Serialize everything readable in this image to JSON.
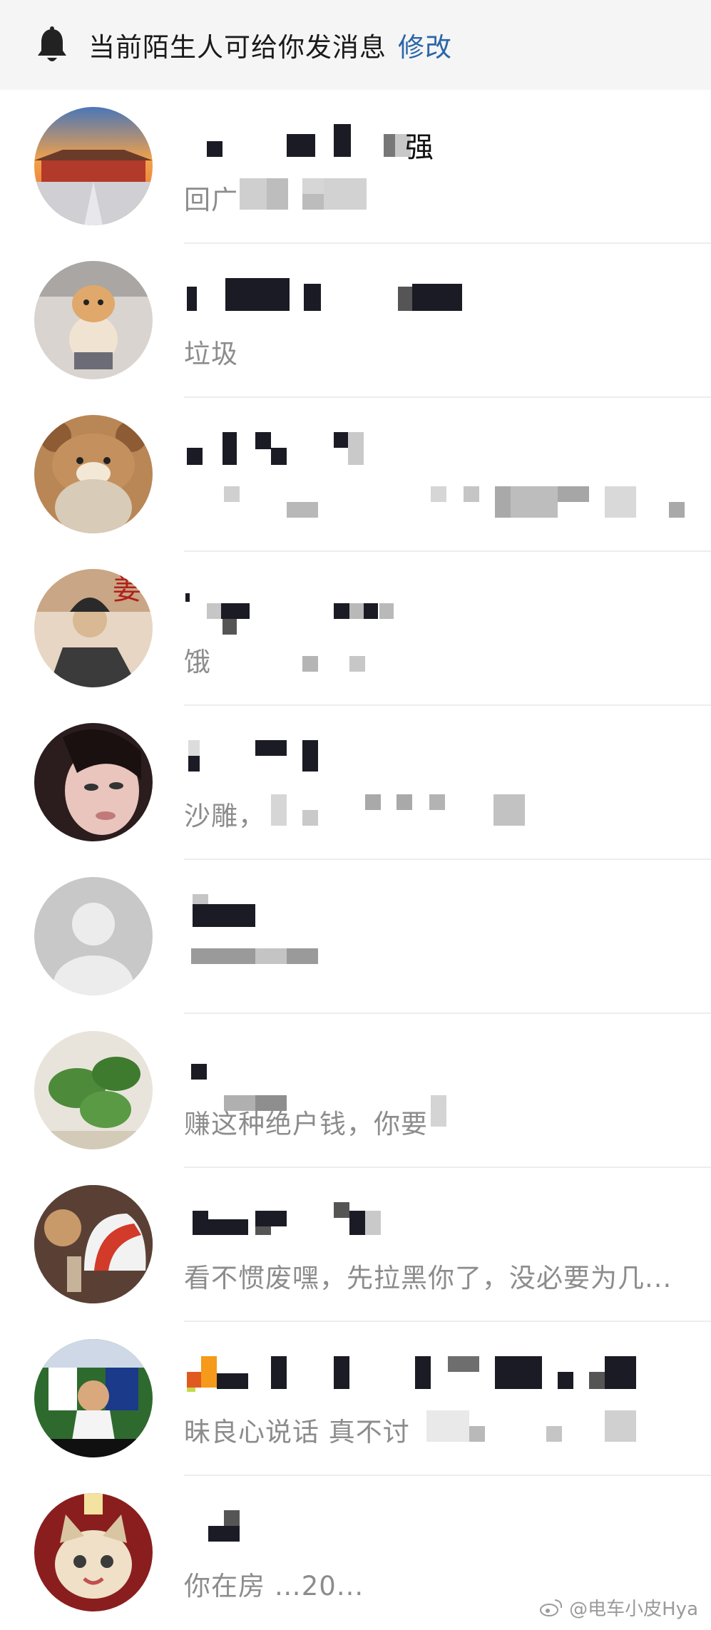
{
  "banner": {
    "icon": "bell-icon",
    "text": "当前陌生人可给你发消息",
    "link": "修改",
    "link_color": "#2b65a8"
  },
  "chats": [
    {
      "name_visible": "强",
      "preview": "回广",
      "avatar": "palace-avatar-icon"
    },
    {
      "name_visible": "",
      "preview": "垃圾",
      "avatar": "dog-avatar-icon"
    },
    {
      "name_visible": "",
      "preview": "",
      "avatar": "bear-avatar-icon"
    },
    {
      "name_visible": "",
      "preview": "饿",
      "avatar": "painting-avatar-icon"
    },
    {
      "name_visible": "",
      "preview": "沙雕，",
      "avatar": "girl-avatar-icon"
    },
    {
      "name_visible": "",
      "preview": "",
      "avatar": "default-person-avatar-icon"
    },
    {
      "name_visible": "",
      "preview": "赚这种绝户钱，你要",
      "avatar": "plant-avatar-icon"
    },
    {
      "name_visible": "",
      "preview": "看不惯废嘿，先拉黑你了，没必要为几...",
      "avatar": "helmet-avatar-icon"
    },
    {
      "name_visible": "",
      "preview": "昧良心说话 真不讨",
      "avatar": "football-avatar-icon"
    },
    {
      "name_visible": "",
      "preview": "你在房                    …20...",
      "avatar": "cat-avatar-icon"
    }
  ],
  "watermark": "@电车小皮Hya"
}
